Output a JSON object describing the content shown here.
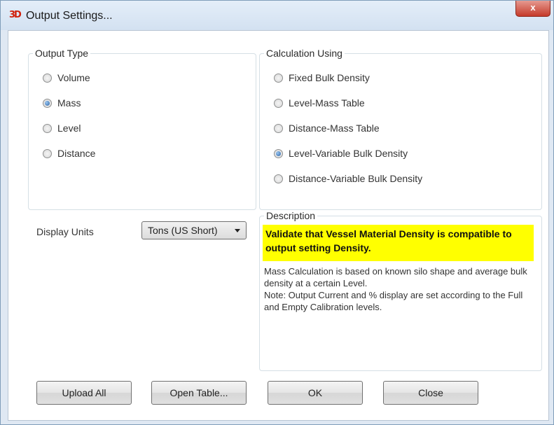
{
  "window": {
    "title": "Output Settings...",
    "app_icon": "3D",
    "close_label": "x"
  },
  "output_type": {
    "label": "Output Type",
    "options": [
      {
        "label": "Volume",
        "checked": false
      },
      {
        "label": "Mass",
        "checked": true
      },
      {
        "label": "Level",
        "checked": false
      },
      {
        "label": "Distance",
        "checked": false
      }
    ]
  },
  "calculation": {
    "label": "Calculation Using",
    "options": [
      {
        "label": "Fixed Bulk Density",
        "checked": false
      },
      {
        "label": "Level-Mass Table",
        "checked": false
      },
      {
        "label": "Distance-Mass Table",
        "checked": false
      },
      {
        "label": "Level-Variable Bulk Density",
        "checked": true
      },
      {
        "label": "Distance-Variable Bulk Density",
        "checked": false
      }
    ]
  },
  "display_units": {
    "label": "Display Units",
    "selected": "Tons (US Short)"
  },
  "description": {
    "label": "Description",
    "warning": "Validate that Vessel Material Density is compatible to output setting Density.",
    "body": "Mass Calculation is based on known silo shape and average bulk density at a certain Level.\nNote: Output Current and % display are set according to the Full and Empty Calibration levels.",
    "warning_color": "#ffff00"
  },
  "buttons": {
    "upload_all": "Upload All",
    "open_table": "Open Table...",
    "ok": "OK",
    "close": "Close"
  }
}
